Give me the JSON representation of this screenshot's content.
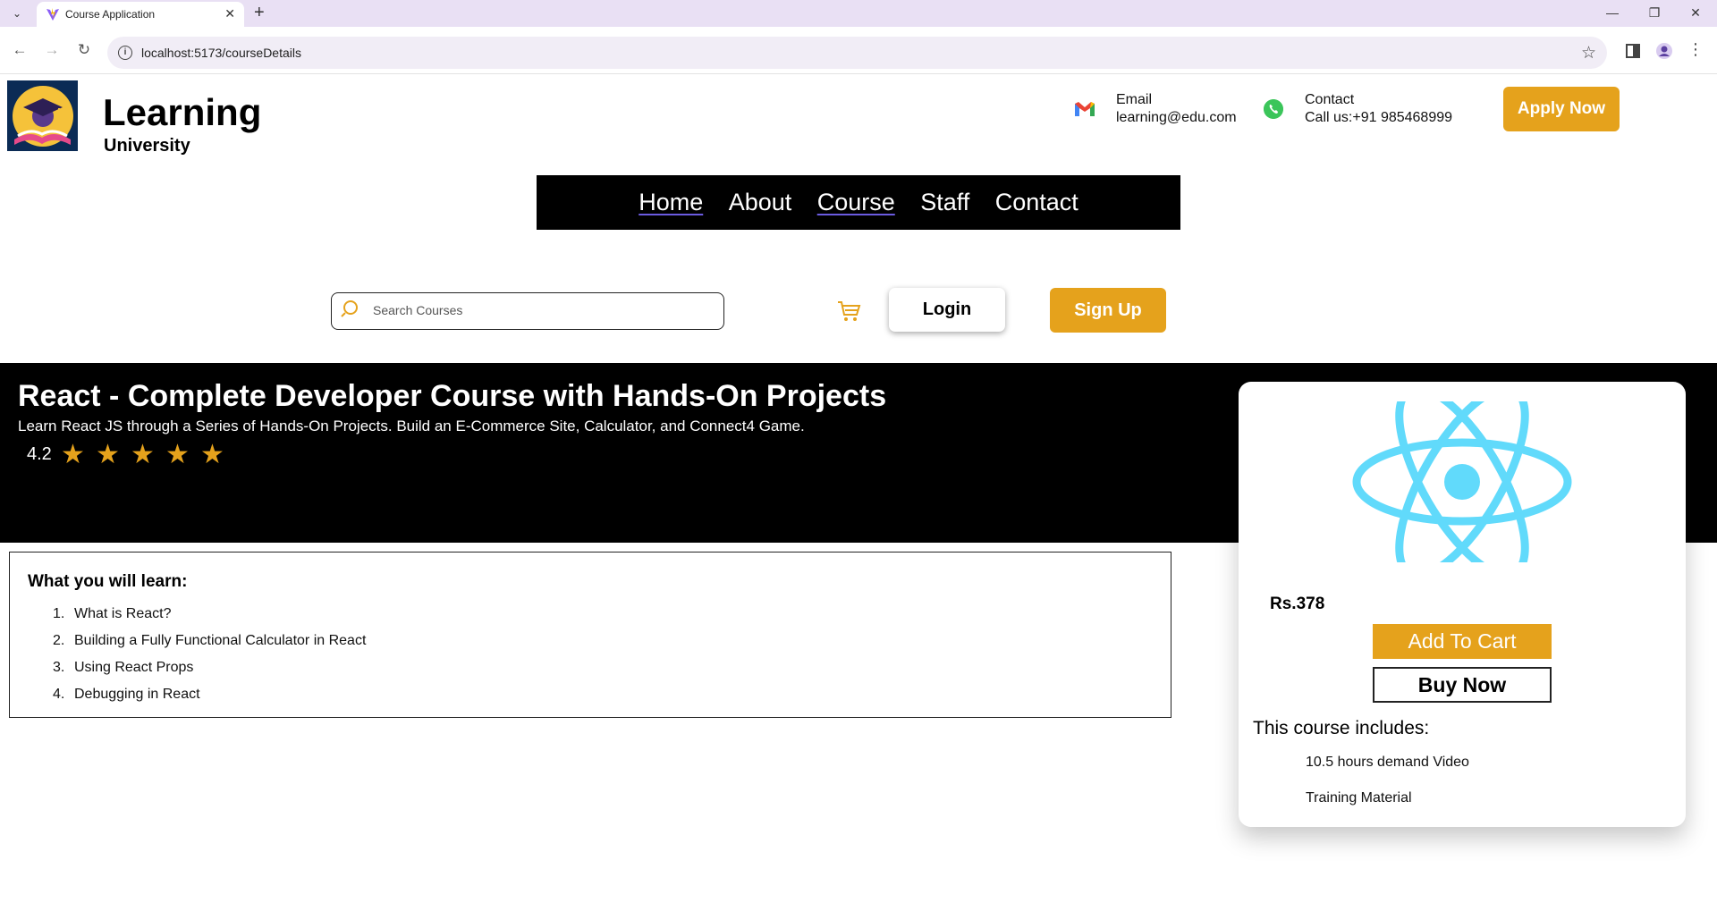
{
  "browser": {
    "tab_title": "Course Application",
    "url": "localhost:5173/courseDetails"
  },
  "header": {
    "brand_title": "Learning",
    "brand_subtitle": "University",
    "email_label": "Email",
    "email_value": "learning@edu.com",
    "contact_label": "Contact",
    "contact_value": "Call us:+91 985468999",
    "apply_label": "Apply Now"
  },
  "nav": {
    "items": [
      {
        "label": "Home"
      },
      {
        "label": "About"
      },
      {
        "label": "Course"
      },
      {
        "label": "Staff"
      },
      {
        "label": "Contact"
      }
    ]
  },
  "actions": {
    "search_placeholder": "Search Courses",
    "login_label": "Login",
    "signup_label": "Sign Up"
  },
  "course": {
    "title": "React - Complete Developer Course with Hands-On Projects",
    "subtitle": "Learn React JS through a Series of Hands-On Projects. Build an E-Commerce Site, Calculator, and Connect4 Game.",
    "rating": "4.2",
    "stars": 5
  },
  "learn": {
    "title": "What you will learn:",
    "items": [
      {
        "num": "1.",
        "text": "What is React?"
      },
      {
        "num": "2.",
        "text": "Building a Fully Functional Calculator in React"
      },
      {
        "num": "3.",
        "text": "Using React Props"
      },
      {
        "num": "4.",
        "text": "Debugging in React"
      }
    ]
  },
  "card": {
    "price": "Rs.378",
    "add_to_cart_label": "Add To Cart",
    "buy_now_label": "Buy Now",
    "includes_title": "This course includes:",
    "includes": [
      {
        "text": "10.5 hours demand Video"
      },
      {
        "text": "Training Material"
      }
    ]
  },
  "colors": {
    "accent": "#e5a21c",
    "hero_bg": "#000000",
    "react_blue": "#61dafb"
  }
}
